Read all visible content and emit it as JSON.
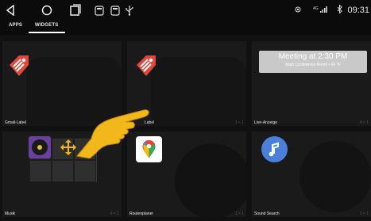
{
  "statusbar": {
    "nav": [
      "back-icon",
      "home-icon",
      "recents-icon"
    ],
    "apps": [
      "screenshot-icon",
      "screenshot-icon",
      "usb-icon"
    ],
    "right_icons": [
      "cast-icon",
      "signal-icon",
      "bluetooth-icon"
    ],
    "signal_text": "ᴴᶠ.▐▄█",
    "clock": "09:31"
  },
  "tabs": {
    "apps": "APPS",
    "widgets": "WIDGETS"
  },
  "widgets": [
    {
      "label": "Gmail-Label",
      "size": ""
    },
    {
      "label": "Label",
      "size": "1 × 1"
    },
    {
      "label": "Live-Anzeige",
      "size": "4 × 1"
    },
    {
      "label": "Musik",
      "size": "4 × 1"
    },
    {
      "label": "Routenplaner",
      "size": "1 × 1"
    },
    {
      "label": "Sound Search",
      "size": "1 × 1"
    }
  ],
  "meeting": {
    "title": "Meeting at 2:30 PM",
    "sub": "Main Conference Room  •  66 °F"
  },
  "colors": {
    "gmail_red": "#e2473b",
    "hand_yellow": "#f2b71a",
    "music_blue": "#4a7fdc"
  }
}
